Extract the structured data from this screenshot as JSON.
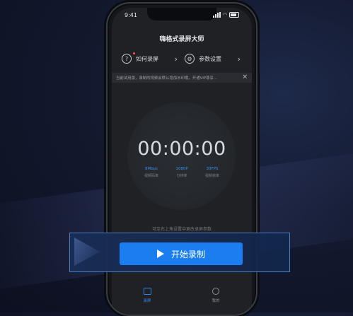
{
  "status": {
    "time": "9:41"
  },
  "header": {
    "title": "嗨格式录屏大师"
  },
  "menu": [
    {
      "label": "如何录屏",
      "icon": "question-icon"
    },
    {
      "label": "参数设置",
      "icon": "gear-icon"
    }
  ],
  "notice": {
    "text": "当前试用版，录制的视频会默认增加水印哦，开通VIP尊享..."
  },
  "recorder": {
    "timer": "00:00:00",
    "params": [
      {
        "value": "8Mbps",
        "label": "视频码率"
      },
      {
        "value": "1080P",
        "label": "分辨率"
      },
      {
        "value": "30FPS",
        "label": "视频帧率"
      }
    ],
    "hint": "可至右上角设置中更改录屏参数"
  },
  "start_button": {
    "label": "开始录制"
  },
  "tabs": [
    {
      "label": "录屏",
      "active": true
    },
    {
      "label": "我的",
      "active": false
    }
  ],
  "colors": {
    "accent": "#1a7ef0",
    "background": "#1f2125"
  }
}
